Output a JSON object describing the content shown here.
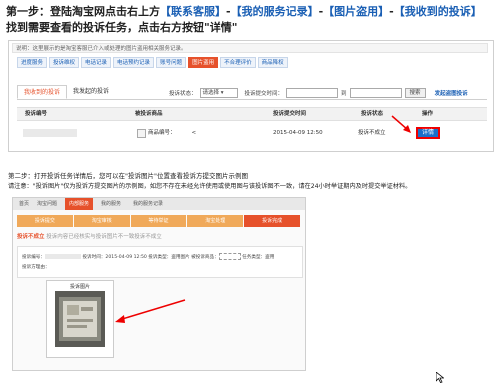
{
  "step1": {
    "prefix": "第一步：登陆淘宝网点击右上方",
    "link1": "【联系客服】",
    "sep1": "-",
    "link2": "【我的服务记录】",
    "sep2": "-",
    "link3": "【图片盗用】",
    "sep3": "-",
    "link4": "【我收到的投诉】",
    "line2": "找到需要查看的投诉任务，点击右方按钮\"详情\""
  },
  "shot1": {
    "notice": "说明：这里展示的是淘宝客服已介入或处理的图片盗用相关服务记录。",
    "service_tabs": [
      "进度服务",
      "投诉维权",
      "电话记录",
      "电话预约记录",
      "账号问题",
      "图片盗用",
      "不合理评价",
      "商品降权"
    ],
    "active_service_tab": "图片盗用",
    "sub_tabs": [
      "我收到的投诉",
      "我发起的投诉"
    ],
    "filter_status_label": "投诉状态：",
    "filter_status_value": "请选择",
    "filter_time_label": "投诉提交时间：",
    "filter_to": "到",
    "search_button": "搜索",
    "report_link": "发起盗图投诉",
    "headers": {
      "id": "投诉编号",
      "party": "被投诉商品",
      "time": "投诉提交时间",
      "status": "投诉状态",
      "op": "操作"
    },
    "row": {
      "item_prefix": "商品编号：",
      "item_suffix": "<",
      "time": "2015-04-09 12:50",
      "status": "投诉不成立",
      "detail": "详情"
    }
  },
  "step2": {
    "line1": "第二步：打开投诉任务详情后，您可以在\"投诉图片\"位置查看投诉方提交图片示例图",
    "line2": "请注意：\"投诉图片\"仅为投诉方提交图片的示例图，如您不存在未经允许使用或使用图与该投诉图不一致，请在24小时举证期内及时提交举证材料。"
  },
  "shot2": {
    "nav": [
      "首页",
      "淘宝问题",
      "内部服务",
      "我的服务",
      "我的服务记录"
    ],
    "steps": [
      "投诉提交",
      "淘宝审核",
      "等待举证",
      "淘宝处理",
      "投诉完成"
    ],
    "result_label": "投诉不成立",
    "result_note": "投诉内容已经核实与投诉图片不一致投诉不成立",
    "info_line1_a": "投诉编号：",
    "info_line1_b": "投诉时间：2015-04-09 12:50",
    "info_line1_c": "投诉类型：盗用图片",
    "info_line1_d": "被投诉商品：",
    "info_line1_e": "任务类型：盗用",
    "info_line2": "投诉方理由：",
    "pic_title": "投诉图片"
  },
  "colors": {
    "accent": "#e6512b",
    "link": "#1a5fb4",
    "highlight": "#e00000"
  }
}
